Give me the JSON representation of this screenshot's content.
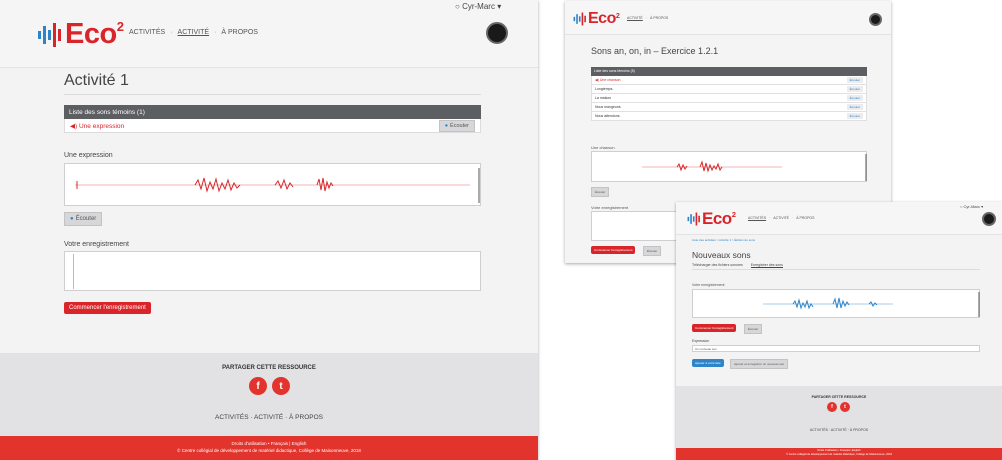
{
  "brand": {
    "name": "Eco",
    "superscript": "2",
    "red": "#d9252a",
    "blue": "#2e84c8",
    "grey_header": "#5d5e62"
  },
  "nav": {
    "items": [
      "ACTIVITÉS",
      "ACTIVITÉ",
      "À PROPOS"
    ],
    "separator": "·",
    "active": "ACTIVITÉ"
  },
  "user": {
    "name": "Cyr-Marc",
    "caret": "▾",
    "icon": "user-icon"
  },
  "shotA": {
    "title": "Activité 1",
    "list_header": "Liste des sons témoins (1)",
    "list_rows": [
      {
        "label": "Une expression",
        "button": "Écouter"
      }
    ],
    "expression_label": "Une expression",
    "play_button": "Écouter",
    "recording_label": "Votre enregistrement",
    "record_button": "Commencer l'enregistrement",
    "share_title": "PARTAGER CETTE RESSOURCE",
    "footer_nav": "ACTIVITÉS · ACTIVITÉ · À PROPOS",
    "footer_links": "Droits d'utilisation  •  Français | English",
    "footer_copyright": "© Centre collégial de développement de matériel didactique, Collège de Maisonneuve, 2018"
  },
  "shotB": {
    "title": "Sons an, on, in – Exercice 1.2.1",
    "list_header": "Liste des sons témoins (5)",
    "list_rows": [
      {
        "label": "Une chanson",
        "button": "Écouter"
      },
      {
        "label": "Longtemps.",
        "button": "Écouter"
      },
      {
        "label": "La maison",
        "button": "Écouter"
      },
      {
        "label": "Nous mangeons.",
        "button": "Écouter"
      },
      {
        "label": "Nous attendons.",
        "button": "Écouter"
      }
    ],
    "expression_label": "Une chanson",
    "play_button": "Écouter",
    "recording_label": "Votre enregistrement",
    "record_button": "Commencer l'enregistrement",
    "play_button2": "Écouter"
  },
  "shotC": {
    "breadcrumb": "Liste des activités  >  Activité 1  >  Édition de sons",
    "title": "Nouveaux sons",
    "tabs": [
      "Télécharger des fichiers sonores",
      "Enregistrer des sons"
    ],
    "active_tab": 1,
    "recording_label": "Votre enregistrement",
    "record_button": "Commencer l'enregistrement",
    "play_button": "Écouter",
    "expression_label": "Expression",
    "expression_value": "Un nouveau son",
    "add_button": "Ajouter à votre liste",
    "save_button": "Ajouter et enregistrer un nouveau son",
    "share_title": "PARTAGER CETTE RESSOURCE",
    "footer_nav": "ACTIVITÉS · ACTIVITÉ · À PROPOS",
    "footer_links": "Droits d'utilisation  •  Français | English",
    "footer_copyright": "© Centre collégial de développement de matériel didactique, Collège de Maisonneuve, 2018"
  },
  "social": {
    "facebook_glyph": "f",
    "twitter_glyph": "t",
    "facebook_icon": "facebook-icon",
    "twitter_icon": "twitter-icon"
  }
}
